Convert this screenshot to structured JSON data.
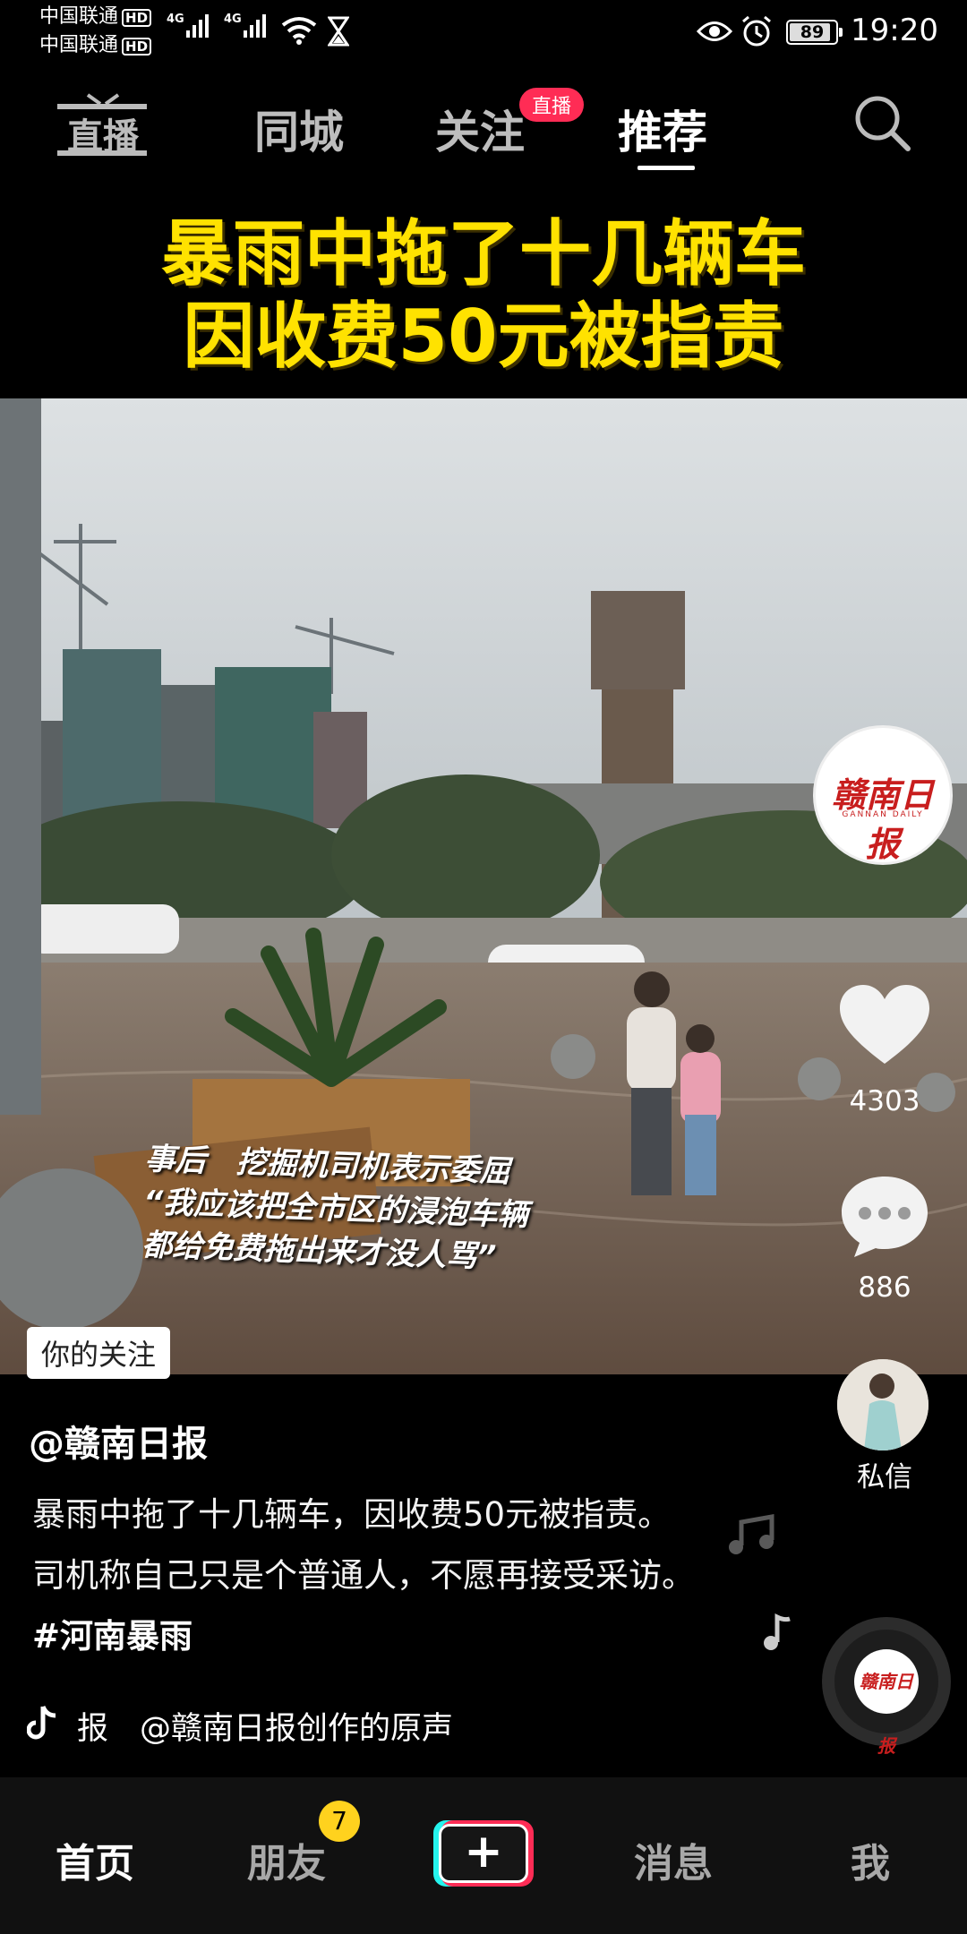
{
  "status_bar": {
    "carrier_1": "中国联通",
    "carrier_2": "中国联通",
    "hd_label": "HD",
    "net_1": "4G",
    "net_2": "4G",
    "battery": "89",
    "battery_level": 0.89,
    "time": "19:20"
  },
  "top_nav": {
    "live_label": "直播",
    "tabs": [
      {
        "label": "同城"
      },
      {
        "label": "关注"
      },
      {
        "label": "推荐"
      }
    ],
    "follow_badge": "直播",
    "active_tab": "推荐"
  },
  "video": {
    "headline_line1": "暴雨中拖了十几辆车",
    "headline_line2": "因收费50元被指责",
    "subtitle_line1": "事后　挖掘机司机表示委屈",
    "subtitle_line2": "“我应该把全市区的浸泡车辆",
    "subtitle_line3": "都给免费拖出来才没人骂”",
    "follow_tag": "你的关注"
  },
  "sidebar": {
    "publisher_logo": "赣南日报",
    "publisher_logo_sub": "GANNAN DAILY",
    "likes": "4303",
    "comments": "886",
    "dm_label": "私信",
    "disc_text": "赣南日报"
  },
  "caption": {
    "author": "@赣南日报",
    "desc_text": "暴雨中拖了十几辆车，因收费50元被指责。司机称自己只是个普通人，不愿再接受采访。",
    "hashtag": "#河南暴雨",
    "music": "报　@赣南日报创作的原声"
  },
  "bottom_nav": {
    "home": "首页",
    "friends": "朋友",
    "friends_badge": "7",
    "post": "+",
    "messages": "消息",
    "me": "我"
  },
  "colors": {
    "accent_pink": "#fe2c55",
    "accent_cyan": "#25f4ee",
    "headline_yellow": "#ffe200",
    "badge_yellow": "#ffd21e"
  }
}
